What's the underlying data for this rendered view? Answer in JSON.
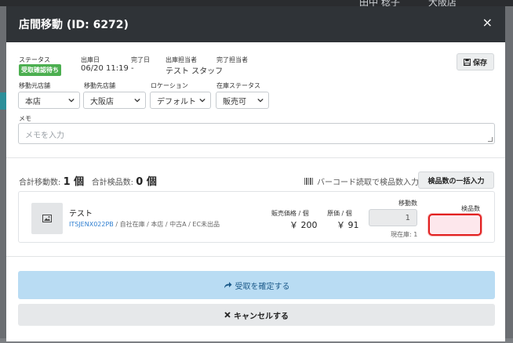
{
  "background": {
    "topbar_text_1": "田中 稔子",
    "topbar_text_2": "大阪店"
  },
  "modal": {
    "title": "店間移動 (ID: 6272)",
    "close_icon": "×"
  },
  "info": {
    "status_label": "ステータス",
    "status_value": "受取確認待ち",
    "shipped_date_label": "出庫日",
    "shipped_date_value": "06/20 11:19",
    "completed_date_label": "完了日",
    "completed_date_value": "-",
    "shipping_staff_label": "出庫担当者",
    "shipping_staff_value": "テスト スタッフ",
    "completing_staff_label": "完了担当者",
    "completing_staff_value": "-",
    "save_label": "保存"
  },
  "selects": {
    "from_store_label": "移動元店舗",
    "from_store_value": "本店",
    "to_store_label": "移動先店舗",
    "to_store_value": "大阪店",
    "location_label": "ロケーション",
    "location_value": "デフォルト",
    "stock_status_label": "在庫ステータス",
    "stock_status_value": "販売可"
  },
  "memo": {
    "label": "メモ",
    "placeholder": "メモを入力"
  },
  "summary": {
    "total_move_label": "合計移動数:",
    "total_move_value": "1 個",
    "total_inspect_label": "合計検品数:",
    "total_inspect_value": "0 個",
    "barcode_label": "バーコード読取で検品数入力",
    "bulk_input_label": "検品数の一括入力"
  },
  "item": {
    "name": "テスト",
    "sku": "ITSJENX022PB",
    "meta": " / 自社在庫 / 本店 / 中古A / EC未出品",
    "sale_price_label": "販売価格 / 個",
    "sale_price_value": "￥ 200",
    "cost_label": "原価 / 個",
    "cost_value": "￥ 91",
    "move_qty_label": "移動数",
    "move_qty_value": "1",
    "current_stock": "現在庫: 1",
    "inspect_qty_label": "検品数"
  },
  "actions": {
    "confirm_label": "受取を確定する",
    "cancel_label": "キャンセルする"
  },
  "colors": {
    "header_bg": "#2f3337",
    "status_badge": "#4caf50",
    "confirm_bg": "#b9dcf3",
    "highlight_border": "#e22020"
  }
}
